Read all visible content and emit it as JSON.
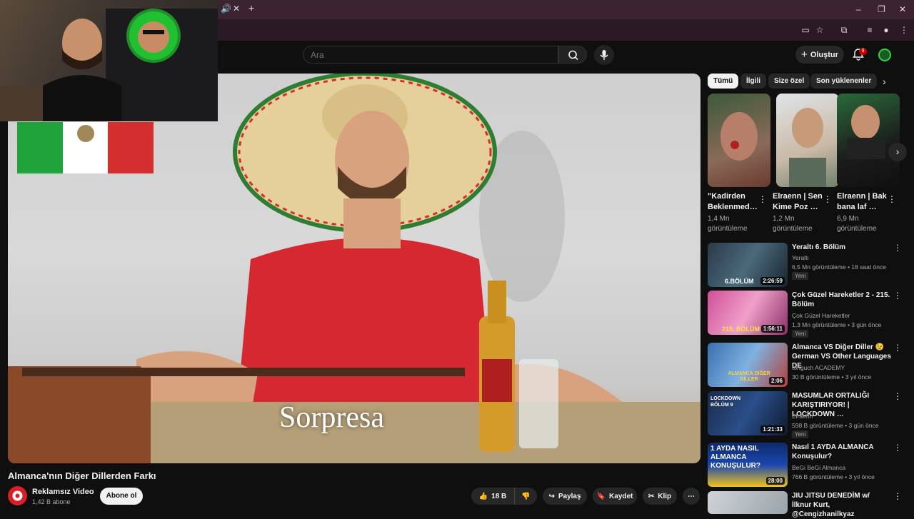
{
  "browser": {
    "tab_audio_icon": "speaker-icon",
    "tab_close": "✕",
    "new_tab": "+",
    "window_controls": [
      "–",
      "❐",
      "✕"
    ]
  },
  "masthead": {
    "search_placeholder": "Ara",
    "create_label": "Oluştur",
    "notifications_count": "9"
  },
  "player": {
    "subtitle": "Sorpresa"
  },
  "video": {
    "title": "Almanca'nın Diğer Dillerden Farkı",
    "channel": "Reklamsız Video",
    "subscribers": "1,42 B abone",
    "subscribe_label": "Abone ol",
    "likes": "18 B",
    "share_label": "Paylaş",
    "save_label": "Kaydet",
    "clip_label": "Klip"
  },
  "chips": [
    "Tümü",
    "İlgili",
    "Size özel",
    "Son yüklenenler"
  ],
  "shorts": [
    {
      "title": "\"Kadirden Beklenmed…",
      "views": "1,4 Mn görüntüleme"
    },
    {
      "title": "Elraenn | Sen Kime Poz …",
      "views": "1,2 Mn görüntüleme"
    },
    {
      "title": "Elraenn | Bak bana laf …",
      "views": "6,9 Mn görüntüleme"
    }
  ],
  "recommended": [
    {
      "title": "Yeraltı 6. Bölüm",
      "channel": "Yeraltı",
      "meta": "6,5 Mn görüntüleme • 18 saat önce",
      "badge": "Yeni",
      "duration": "2:26:59",
      "thumb_text": "6.BÖLÜM"
    },
    {
      "title": "Çok Güzel Hareketler 2 - 215. Bölüm",
      "channel": "Çok Güzel Hareketler",
      "meta": "1,3 Mn görüntüleme • 3 gün önce",
      "badge": "Yeni",
      "duration": "1:56:11",
      "thumb_text": "215. BÖLÜM"
    },
    {
      "title": "Almanca VS Diğer Diller 😉 German VS Other Languages DE",
      "channel": "tonguch ACADEMY",
      "meta": "30 B görüntüleme • 3 yıl önce",
      "badge": "",
      "duration": "2:06",
      "thumb_text": "ALMANCA DİĞER DİLLER"
    },
    {
      "title": "MASUMLAR ORTALIĞI KARIŞTIRIYOR! | LOCKDOWN …",
      "channel": "Elraenn",
      "meta": "598 B görüntüleme • 3 gün önce",
      "badge": "Yeni",
      "duration": "1:21:33",
      "thumb_text": "LOCKDOWN BÖLÜM 9"
    },
    {
      "title": "Nasıl 1 AYDA ALMANCA Konuşulur?",
      "channel": "BeGi BeGi Almanca",
      "meta": "766 B görüntüleme • 3 yıl önce",
      "badge": "",
      "duration": "28:00",
      "thumb_text": "1 AYDA NASIL ALMANCA KONUŞULUR?"
    },
    {
      "title": "JIU JITSU DENEDİM w/ İlknur Kurt, @Cengizhanilkyaz",
      "channel": "",
      "meta": "",
      "badge": "",
      "duration": "",
      "thumb_text": ""
    }
  ],
  "colors": {
    "accent": "#cc0000",
    "background": "#0f0f0f",
    "chrome_tab": "#3a2430"
  }
}
